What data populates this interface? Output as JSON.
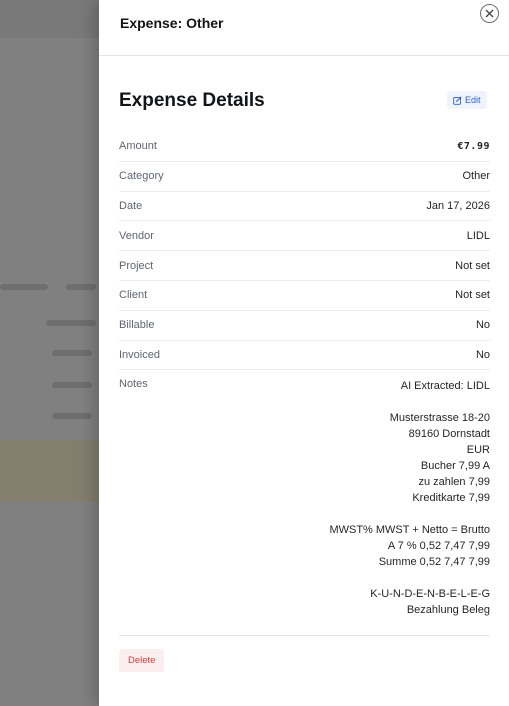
{
  "drawer": {
    "title": "Expense: Other",
    "section_title": "Expense Details",
    "edit_label": "Edit",
    "delete_label": "Delete"
  },
  "details": [
    {
      "label": "Amount",
      "value": "€7.99"
    },
    {
      "label": "Category",
      "value": "Other"
    },
    {
      "label": "Date",
      "value": "Jan 17, 2026"
    },
    {
      "label": "Vendor",
      "value": "LIDL"
    },
    {
      "label": "Project",
      "value": "Not set"
    },
    {
      "label": "Client",
      "value": "Not set"
    },
    {
      "label": "Billable",
      "value": "No"
    },
    {
      "label": "Invoiced",
      "value": "No"
    }
  ],
  "notes": {
    "label": "Notes",
    "paragraphs": [
      [
        "AI Extracted: LIDL"
      ],
      [
        "Musterstrasse 18-20",
        "89160 Dornstadt",
        "EUR",
        "Bucher 7,99 A",
        "zu zahlen 7,99",
        "Kreditkarte 7,99"
      ],
      [
        "MWST% MWST + Netto = Brutto",
        "A 7 % 0,52 7,47 7,99",
        "Summe 0,52 7,47 7,99"
      ],
      [
        "K-U-N-D-E-N-B-E-L-E-G",
        "Bezahlung Beleg"
      ]
    ]
  },
  "icons": {
    "close": "close-icon",
    "edit": "edit-icon"
  },
  "colors": {
    "edit_accent": "#2f5fce",
    "delete_accent": "#d23b3b"
  }
}
